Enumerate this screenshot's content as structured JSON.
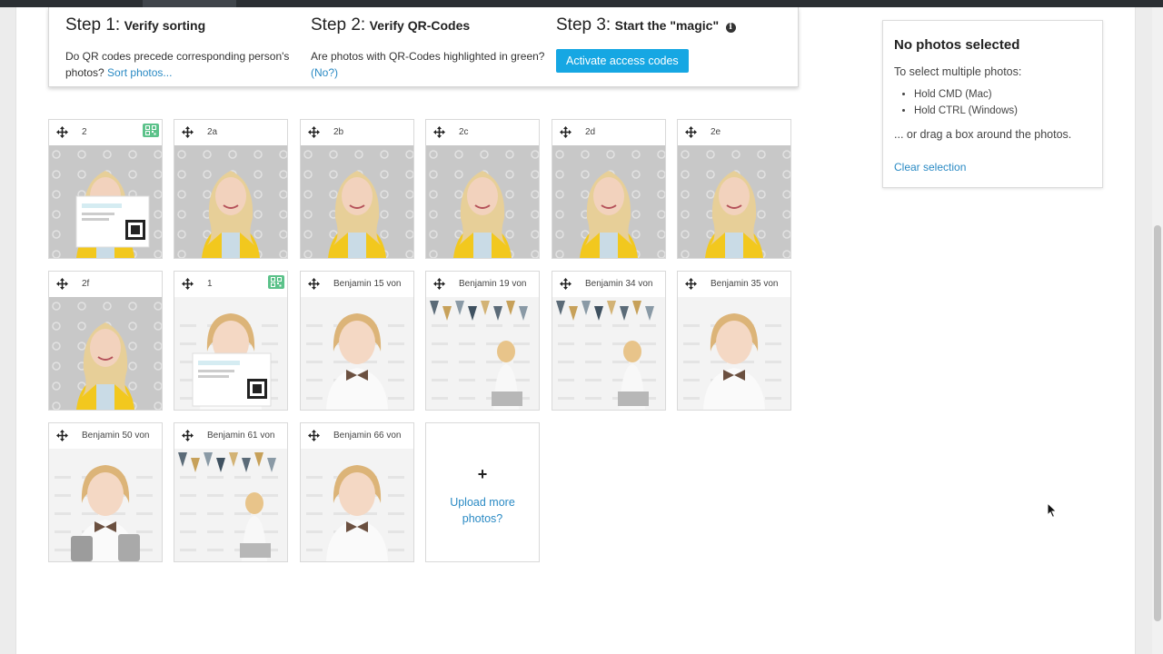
{
  "steps": [
    {
      "num": "Step 1:",
      "title": "Verify sorting",
      "text": "Do QR codes precede corresponding person's photos?",
      "link": "Sort photos..."
    },
    {
      "num": "Step 2:",
      "title": "Verify QR-Codes",
      "text": "Are photos with QR-Codes highlighted in green?",
      "link": "(No?)"
    },
    {
      "num": "Step 3:",
      "title": "Start the \"magic\"",
      "info_icon": "info-icon",
      "button": "Activate access codes"
    }
  ],
  "photos": [
    {
      "label": "2",
      "qr": true,
      "subject": "girl"
    },
    {
      "label": "2a",
      "qr": false,
      "subject": "girl"
    },
    {
      "label": "2b",
      "qr": false,
      "subject": "girl"
    },
    {
      "label": "2c",
      "qr": false,
      "subject": "girl"
    },
    {
      "label": "2d",
      "qr": false,
      "subject": "girl"
    },
    {
      "label": "2e",
      "qr": false,
      "subject": "girl"
    },
    {
      "label": "2f",
      "qr": false,
      "subject": "girl"
    },
    {
      "label": "1",
      "qr": true,
      "subject": "boy"
    },
    {
      "label": "Benjamin 15 von",
      "qr": false,
      "subject": "boy"
    },
    {
      "label": "Benjamin 19 von",
      "qr": false,
      "subject": "boy"
    },
    {
      "label": "Benjamin 34 von",
      "qr": false,
      "subject": "boy"
    },
    {
      "label": "Benjamin 35 von",
      "qr": false,
      "subject": "boy"
    },
    {
      "label": "Benjamin 50 von",
      "qr": false,
      "subject": "boy"
    },
    {
      "label": "Benjamin 61 von",
      "qr": false,
      "subject": "boy"
    },
    {
      "label": "Benjamin 66 von",
      "qr": false,
      "subject": "boy"
    }
  ],
  "upload": {
    "plus": "+",
    "text": "Upload more photos?"
  },
  "selection": {
    "title": "No photos selected",
    "intro": "To select multiple photos:",
    "items": [
      "Hold CMD (Mac)",
      "Hold CTRL (Windows)"
    ],
    "drag": "... or drag a box around the photos.",
    "clear": "Clear selection"
  },
  "colors": {
    "accent": "#16a7e3",
    "link": "#2a8ac4",
    "qr_badge": "#5cc28a",
    "girl_shirt": "#f2c81e",
    "studio_bg": "#c8c8c8"
  },
  "icons": {
    "move": "move-icon",
    "qr": "qr-code-icon",
    "cursor": "mouse-cursor-icon"
  }
}
